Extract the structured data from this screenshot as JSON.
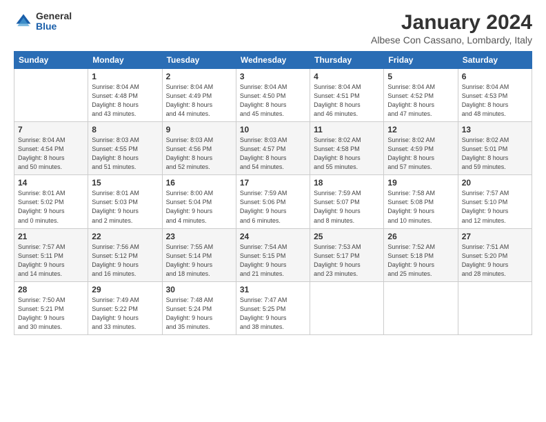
{
  "logo": {
    "general": "General",
    "blue": "Blue"
  },
  "header": {
    "month": "January 2024",
    "location": "Albese Con Cassano, Lombardy, Italy"
  },
  "weekdays": [
    "Sunday",
    "Monday",
    "Tuesday",
    "Wednesday",
    "Thursday",
    "Friday",
    "Saturday"
  ],
  "weeks": [
    [
      {
        "day": "",
        "info": ""
      },
      {
        "day": "1",
        "info": "Sunrise: 8:04 AM\nSunset: 4:48 PM\nDaylight: 8 hours\nand 43 minutes."
      },
      {
        "day": "2",
        "info": "Sunrise: 8:04 AM\nSunset: 4:49 PM\nDaylight: 8 hours\nand 44 minutes."
      },
      {
        "day": "3",
        "info": "Sunrise: 8:04 AM\nSunset: 4:50 PM\nDaylight: 8 hours\nand 45 minutes."
      },
      {
        "day": "4",
        "info": "Sunrise: 8:04 AM\nSunset: 4:51 PM\nDaylight: 8 hours\nand 46 minutes."
      },
      {
        "day": "5",
        "info": "Sunrise: 8:04 AM\nSunset: 4:52 PM\nDaylight: 8 hours\nand 47 minutes."
      },
      {
        "day": "6",
        "info": "Sunrise: 8:04 AM\nSunset: 4:53 PM\nDaylight: 8 hours\nand 48 minutes."
      }
    ],
    [
      {
        "day": "7",
        "info": "Sunrise: 8:04 AM\nSunset: 4:54 PM\nDaylight: 8 hours\nand 50 minutes."
      },
      {
        "day": "8",
        "info": "Sunrise: 8:03 AM\nSunset: 4:55 PM\nDaylight: 8 hours\nand 51 minutes."
      },
      {
        "day": "9",
        "info": "Sunrise: 8:03 AM\nSunset: 4:56 PM\nDaylight: 8 hours\nand 52 minutes."
      },
      {
        "day": "10",
        "info": "Sunrise: 8:03 AM\nSunset: 4:57 PM\nDaylight: 8 hours\nand 54 minutes."
      },
      {
        "day": "11",
        "info": "Sunrise: 8:02 AM\nSunset: 4:58 PM\nDaylight: 8 hours\nand 55 minutes."
      },
      {
        "day": "12",
        "info": "Sunrise: 8:02 AM\nSunset: 4:59 PM\nDaylight: 8 hours\nand 57 minutes."
      },
      {
        "day": "13",
        "info": "Sunrise: 8:02 AM\nSunset: 5:01 PM\nDaylight: 8 hours\nand 59 minutes."
      }
    ],
    [
      {
        "day": "14",
        "info": "Sunrise: 8:01 AM\nSunset: 5:02 PM\nDaylight: 9 hours\nand 0 minutes."
      },
      {
        "day": "15",
        "info": "Sunrise: 8:01 AM\nSunset: 5:03 PM\nDaylight: 9 hours\nand 2 minutes."
      },
      {
        "day": "16",
        "info": "Sunrise: 8:00 AM\nSunset: 5:04 PM\nDaylight: 9 hours\nand 4 minutes."
      },
      {
        "day": "17",
        "info": "Sunrise: 7:59 AM\nSunset: 5:06 PM\nDaylight: 9 hours\nand 6 minutes."
      },
      {
        "day": "18",
        "info": "Sunrise: 7:59 AM\nSunset: 5:07 PM\nDaylight: 9 hours\nand 8 minutes."
      },
      {
        "day": "19",
        "info": "Sunrise: 7:58 AM\nSunset: 5:08 PM\nDaylight: 9 hours\nand 10 minutes."
      },
      {
        "day": "20",
        "info": "Sunrise: 7:57 AM\nSunset: 5:10 PM\nDaylight: 9 hours\nand 12 minutes."
      }
    ],
    [
      {
        "day": "21",
        "info": "Sunrise: 7:57 AM\nSunset: 5:11 PM\nDaylight: 9 hours\nand 14 minutes."
      },
      {
        "day": "22",
        "info": "Sunrise: 7:56 AM\nSunset: 5:12 PM\nDaylight: 9 hours\nand 16 minutes."
      },
      {
        "day": "23",
        "info": "Sunrise: 7:55 AM\nSunset: 5:14 PM\nDaylight: 9 hours\nand 18 minutes."
      },
      {
        "day": "24",
        "info": "Sunrise: 7:54 AM\nSunset: 5:15 PM\nDaylight: 9 hours\nand 21 minutes."
      },
      {
        "day": "25",
        "info": "Sunrise: 7:53 AM\nSunset: 5:17 PM\nDaylight: 9 hours\nand 23 minutes."
      },
      {
        "day": "26",
        "info": "Sunrise: 7:52 AM\nSunset: 5:18 PM\nDaylight: 9 hours\nand 25 minutes."
      },
      {
        "day": "27",
        "info": "Sunrise: 7:51 AM\nSunset: 5:20 PM\nDaylight: 9 hours\nand 28 minutes."
      }
    ],
    [
      {
        "day": "28",
        "info": "Sunrise: 7:50 AM\nSunset: 5:21 PM\nDaylight: 9 hours\nand 30 minutes."
      },
      {
        "day": "29",
        "info": "Sunrise: 7:49 AM\nSunset: 5:22 PM\nDaylight: 9 hours\nand 33 minutes."
      },
      {
        "day": "30",
        "info": "Sunrise: 7:48 AM\nSunset: 5:24 PM\nDaylight: 9 hours\nand 35 minutes."
      },
      {
        "day": "31",
        "info": "Sunrise: 7:47 AM\nSunset: 5:25 PM\nDaylight: 9 hours\nand 38 minutes."
      },
      {
        "day": "",
        "info": ""
      },
      {
        "day": "",
        "info": ""
      },
      {
        "day": "",
        "info": ""
      }
    ]
  ]
}
